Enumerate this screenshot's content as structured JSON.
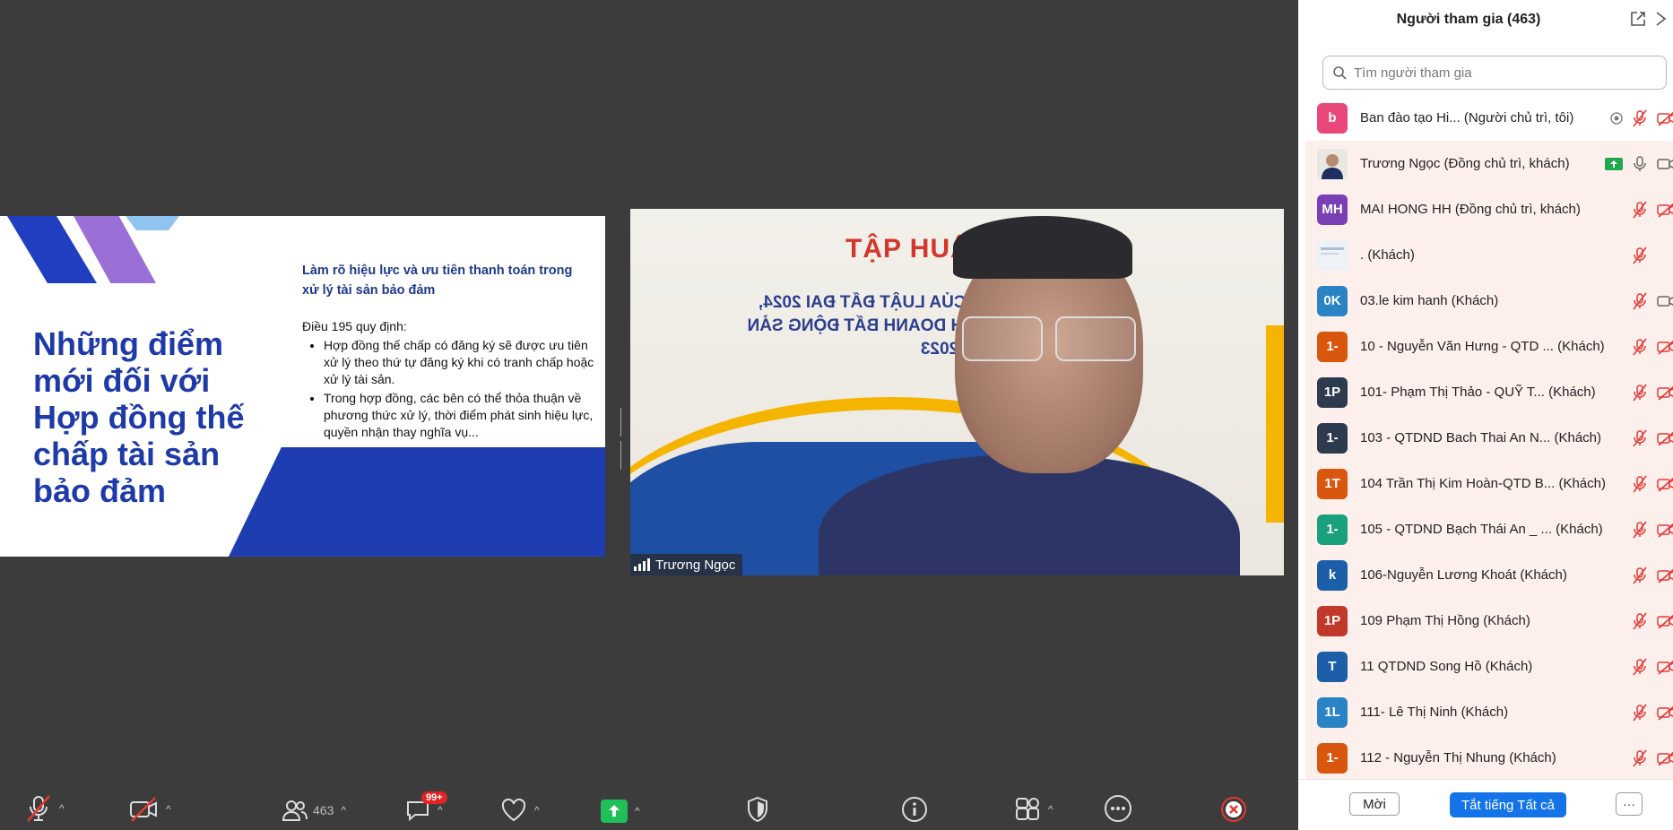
{
  "slide": {
    "title": "Những điểm mới đối với Hợp đồng thế chấp tài sản bảo đảm",
    "subtitle": "Làm rõ hiệu lực và ưu tiên thanh toán trong xử lý tài sản bảo đảm",
    "intro": "Điều 195 quy định:",
    "bullets": [
      "Hợp đồng thế chấp có đăng ký sẽ được ưu tiên xử lý theo thứ tự đăng ký khi có tranh chấp hoặc xử lý tài sản.",
      "Trong hợp đồng, các bên có thể thỏa thuận về phương thức xử lý, thời điểm phát sinh hiệu lực, quyền nhận thay nghĩa vụ..."
    ]
  },
  "video": {
    "banner_title": "TẬP HUẤN",
    "banner_mirror": "NHỮNG ĐIỂM MỚI CỦA LUẬT ĐẤT ĐAI 2024, LUẬT NHÀ Ở VÀ KINH DOANH BẤT ĐỘNG SẢN 2023",
    "speaker_name": "Trương Ngọc"
  },
  "toolbar": {
    "participant_count": "463",
    "chat_badge": "99+"
  },
  "panel": {
    "title": "Người tham gia (463)",
    "search_placeholder": "Tìm người tham gia",
    "invite_label": "Mời",
    "mute_all_label": "Tắt tiếng Tất cả",
    "more_label": "···",
    "participants": [
      {
        "initials": "b",
        "color": "#e8497a",
        "name": "Ban đào tạo Hi... (Người chủ trì, tôi)",
        "mic": "muted",
        "cam": "off",
        "extra": "rec",
        "hl": false
      },
      {
        "initials": "",
        "color": "#8a8f99",
        "name": "Trương Ngọc (Đồng chủ trì, khách)",
        "mic": "on",
        "cam": "on",
        "extra": "share",
        "photo": true,
        "hl": true
      },
      {
        "initials": "MH",
        "color": "#7b3fb5",
        "name": "MAI HONG HH (Đồng chủ trì, khách)",
        "mic": "muted",
        "cam": "off",
        "hl": true
      },
      {
        "initials": "",
        "color": "#d9e6f2",
        "name": ". (Khách)",
        "mic": "muted",
        "cam": "none",
        "thumb": true,
        "hl": true
      },
      {
        "initials": "0K",
        "color": "#2a83c4",
        "name": "03.le kim hanh (Khách)",
        "mic": "muted",
        "cam": "on",
        "hl": true
      },
      {
        "initials": "1-",
        "color": "#d9560f",
        "name": "10 - Nguyễn Văn Hưng - QTD ... (Khách)",
        "mic": "muted",
        "cam": "off",
        "hl": true
      },
      {
        "initials": "1P",
        "color": "#2e3b4e",
        "name": "101- Phạm Thị Thảo - QUỸ T... (Khách)",
        "mic": "muted",
        "cam": "off",
        "hl": true
      },
      {
        "initials": "1-",
        "color": "#2e3b4e",
        "name": "103 - QTDND Bach Thai An N... (Khách)",
        "mic": "muted",
        "cam": "off",
        "hl": true
      },
      {
        "initials": "1T",
        "color": "#d9560f",
        "name": "104 Trần Thị Kim Hoàn-QTD B... (Khách)",
        "mic": "muted",
        "cam": "off",
        "hl": true
      },
      {
        "initials": "1-",
        "color": "#1aa07c",
        "name": "105 - QTDND Bạch Thái An _ ... (Khách)",
        "mic": "muted",
        "cam": "off",
        "hl": true
      },
      {
        "initials": "k",
        "color": "#1c5fa8",
        "name": "106-Nguyễn Lương Khoát (Khách)",
        "mic": "muted",
        "cam": "off",
        "hl": true
      },
      {
        "initials": "1P",
        "color": "#c0392b",
        "name": "109 Phạm Thị Hồng (Khách)",
        "mic": "muted",
        "cam": "off",
        "hl": true
      },
      {
        "initials": "T",
        "color": "#1c5fa8",
        "name": "11 QTDND Song Hồ (Khách)",
        "mic": "muted",
        "cam": "off",
        "hl": true
      },
      {
        "initials": "1L",
        "color": "#2a83c4",
        "name": "111- Lê Thị Ninh (Khách)",
        "mic": "muted",
        "cam": "off",
        "hl": true
      },
      {
        "initials": "1-",
        "color": "#d9560f",
        "name": "112 - Nguyễn Thị Nhung (Khách)",
        "mic": "muted",
        "cam": "off",
        "hl": true
      }
    ]
  }
}
